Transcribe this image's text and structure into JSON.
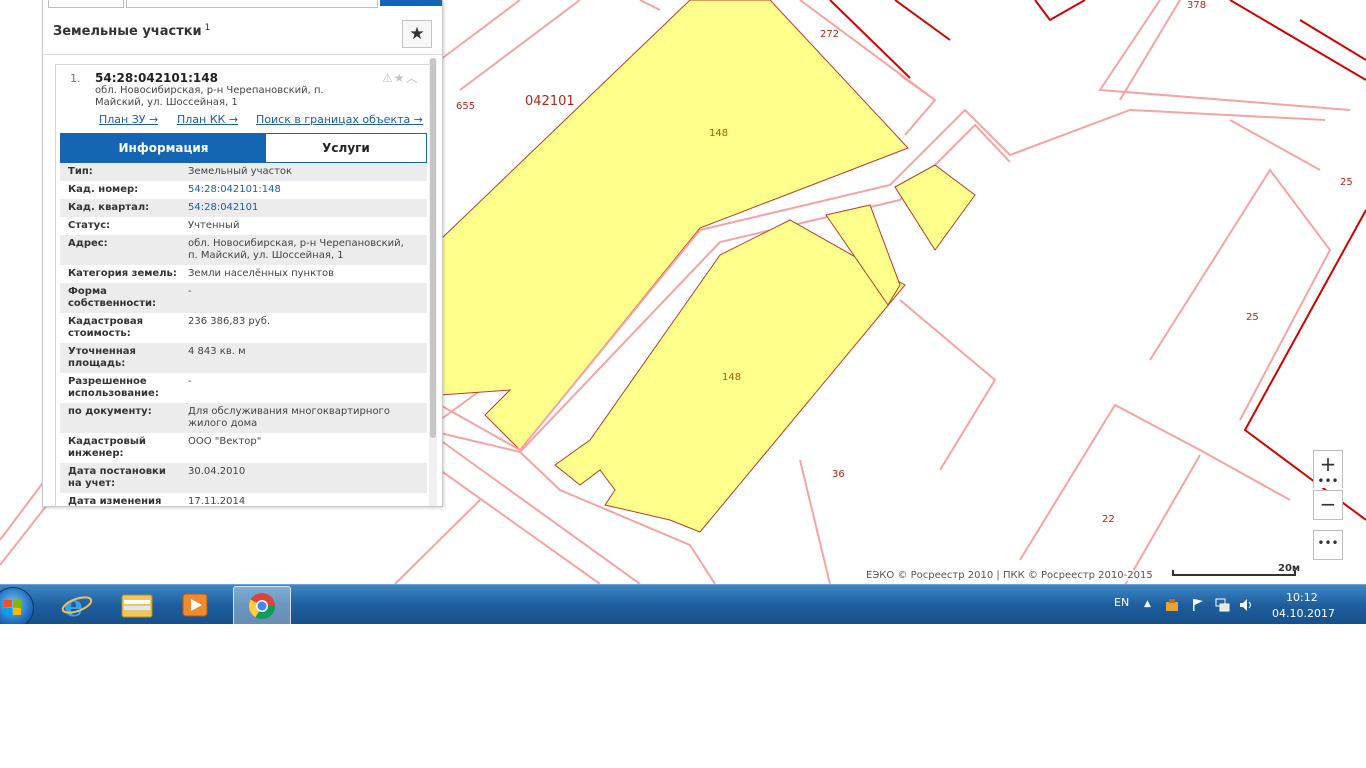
{
  "colors": {
    "parcel_fill": "#ffff88",
    "parcel_border": "#c0392b",
    "road_outline": "#f4a0a0",
    "quarter_border": "#d40000",
    "tab_active": "#1565b5",
    "taskbar": "#1e5e9e"
  },
  "panel": {
    "title": "Земельные участки",
    "count": "1",
    "favorites_icon": "star-icon",
    "result": {
      "number": "1.",
      "cad_number": "54:28:042101:148",
      "address": "обл. Новосибирская, р-н Черепановский, п. Майский, ул. Шоссейная, 1",
      "action_icons": "⚠★︿",
      "links": {
        "plan_zu": "План ЗУ →",
        "plan_kk": "План КК →",
        "search_in_bounds": "Поиск в границах объекта →"
      },
      "tabs": {
        "info": "Информация",
        "services": "Услуги"
      },
      "info_rows": [
        {
          "label": "Тип:",
          "value": "Земельный участок"
        },
        {
          "label": "Кад. номер:",
          "value": "54:28:042101:148"
        },
        {
          "label": "Кад. квартал:",
          "value": "54:28:042101"
        },
        {
          "label": "Статус:",
          "value": "Учтенный"
        },
        {
          "label": "Адрес:",
          "value": "обл. Новосибирская, р-н Черепановский, п. Майский, ул. Шоссейная, 1"
        },
        {
          "label": "Категория земель:",
          "value": "Земли населённых пунктов"
        },
        {
          "label": "Форма собственности:",
          "value": "-"
        },
        {
          "label": "Кадастровая стоимость:",
          "value": "236 386,83 руб."
        },
        {
          "label": "Уточненная площадь:",
          "value": "4 843 кв. м"
        },
        {
          "label": "Разрешенное использование:",
          "value": "-"
        },
        {
          "label": "по документу:",
          "value": "Для обслуживания многоквартирного жилого дома"
        },
        {
          "label": "Кадастровый инженер:",
          "value": "ООО \"Вектор\""
        },
        {
          "label": "Дата постановки на учет:",
          "value": "30.04.2010"
        },
        {
          "label": "Дата изменения",
          "value": "17.11.2014"
        }
      ]
    }
  },
  "map": {
    "quarter_label": "042101",
    "labels": [
      "655",
      "272",
      "148",
      "148",
      "36",
      "25",
      "25",
      "22",
      "378"
    ],
    "controls": {
      "zoom_in": "+",
      "zoom_out": "−",
      "dots": "•••",
      "more": "•••"
    },
    "attribution": "ЕЭКО © Росреестр 2010 | ПКК © Росреестр 2010-2015",
    "scale": "20м"
  },
  "taskbar": {
    "apps": [
      "start-orb",
      "internet-explorer-icon",
      "file-explorer-icon",
      "media-player-icon",
      "chrome-icon"
    ],
    "language": "EN",
    "time": "10:12",
    "date": "04.10.2017"
  }
}
